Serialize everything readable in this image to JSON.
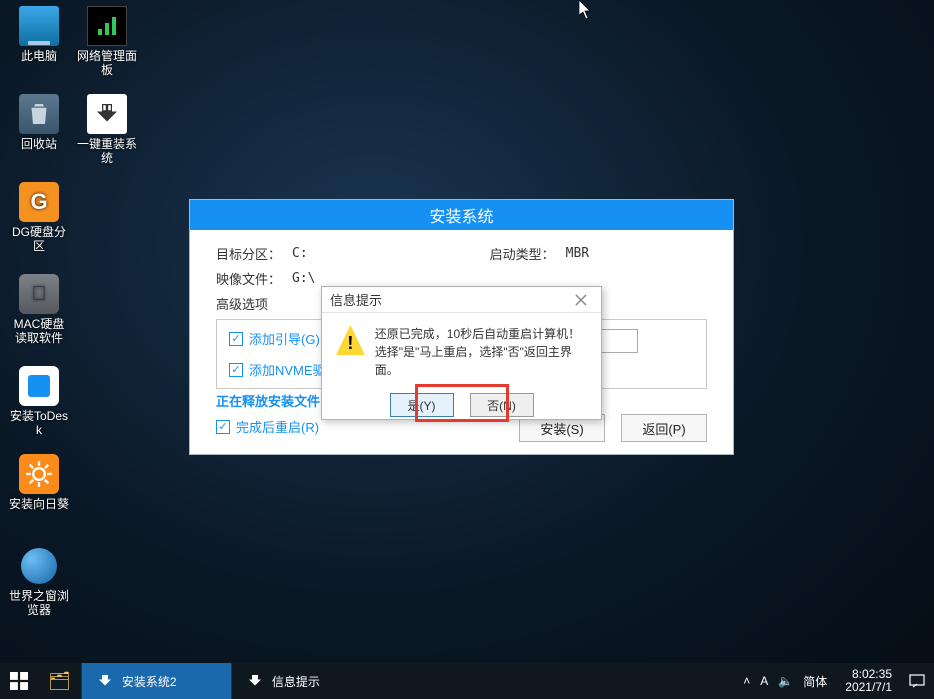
{
  "desktop": {
    "icons": [
      {
        "label": "此电脑"
      },
      {
        "label": "网络管理面板"
      },
      {
        "label": "回收站"
      },
      {
        "label": "一键重装系统"
      },
      {
        "label": "DG硬盘分区"
      },
      {
        "label": "MAC硬盘读取软件"
      },
      {
        "label": "安装ToDesk"
      },
      {
        "label": "安装向日葵"
      },
      {
        "label": "世界之窗浏览器"
      }
    ]
  },
  "installer": {
    "title": "安装系统",
    "rows": {
      "target_label": "目标分区：",
      "target_value": "C:",
      "boot_label": "启动类型：",
      "boot_value": "MBR",
      "image_label": "映像文件：",
      "image_value": "G:\\"
    },
    "advanced_label": "高级选项",
    "checks": {
      "boot_guide": "添加引导(G):",
      "nvme": "添加NVME驱",
      "reboot_after": "完成后重启(R)"
    },
    "status": "正在释放安装文件",
    "buttons": {
      "install": "安装(S)",
      "back": "返回(P)"
    }
  },
  "modal": {
    "title": "信息提示",
    "line1": "还原已完成，10秒后自动重启计算机！",
    "line2": "选择\"是\"马上重启，选择\"否\"返回主界面。",
    "yes": "是(Y)",
    "no": "否(N)"
  },
  "taskbar": {
    "task1": "安装系统2",
    "task2": "信息提示",
    "ime_icon": "A",
    "ime_text": "简体",
    "time": "8:02:35",
    "date": "2021/7/1"
  }
}
